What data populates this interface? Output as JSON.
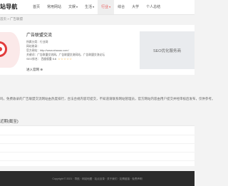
{
  "header": {
    "logo": "站导航",
    "nav": [
      {
        "label": "首页"
      },
      {
        "label": "常用网站"
      },
      {
        "label": "文娱",
        "caret": "▾"
      },
      {
        "label": "生活",
        "caret": "▾"
      },
      {
        "label": "行业",
        "caret": "▾",
        "active": true
      },
      {
        "label": "综合"
      },
      {
        "label": "大学"
      },
      {
        "label": "个人总结"
      }
    ]
  },
  "breadcrumb": "首页 » 广告联盟",
  "site": {
    "title": "广告联盟交流",
    "rows": {
      "domain": "所属分类：行业网",
      "category": "网站收录：",
      "url": "官方网站：http://www.ahaoao.com/",
      "tags": "关键词：广告联盟交流网，广告联盟交流网站，广告联盟交流论坛",
      "rank_label": "SEO排名：",
      "rank_value": "百度权重 5.6"
    },
    "stars": "☆☆☆☆☆",
    "fav_button": "进入官网 ⊕"
  },
  "seo_box": "SEO优化服务商",
  "notice": "吗，免费收录的广告联盟交流网站由热度排行，合法合规内容可提交，不知道请联系网站管理员，官方网站内容由用户提交并经审核后发布，仅供参考。",
  "section_title": "近期(截至)",
  "footer": "Copyright © 2021 · 导航  · 网站地图 · 站点目录 · 关于我们 · 友情链接 · 免责声明"
}
